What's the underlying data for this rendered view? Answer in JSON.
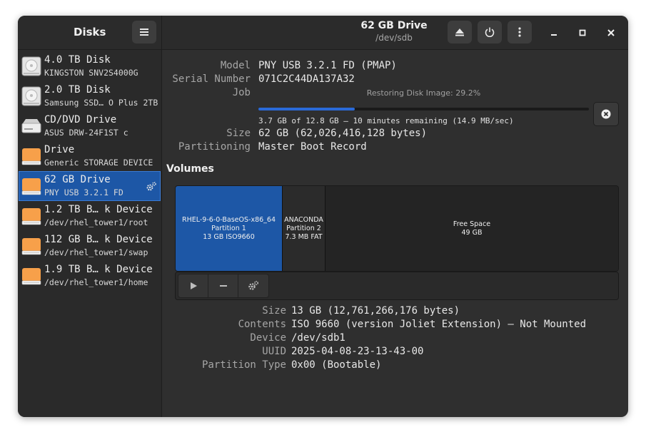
{
  "app": {
    "title": "Disks"
  },
  "header": {
    "title": "62 GB Drive",
    "subtitle": "/dev/sdb"
  },
  "sidebar": {
    "items": [
      {
        "name": "4.0 TB Disk",
        "desc": "KINGSTON SNV2S4000G",
        "icon": "hdd-icon"
      },
      {
        "name": "2.0 TB Disk",
        "desc": "Samsung SSD… O Plus 2TB",
        "icon": "hdd-icon"
      },
      {
        "name": "CD/DVD Drive",
        "desc": "ASUS    DRW-24F1ST   c",
        "icon": "optical-drive-icon"
      },
      {
        "name": "Drive",
        "desc": "Generic STORAGE DEVICE",
        "icon": "removable-drive-icon"
      },
      {
        "name": "62 GB Drive",
        "desc": "PNY USB 3.2.1 FD",
        "icon": "removable-drive-icon",
        "selected": true
      },
      {
        "name": "1.2 TB B… k Device",
        "desc": "/dev/rhel_tower1/root",
        "icon": "block-device-icon"
      },
      {
        "name": "112 GB B… k Device",
        "desc": "/dev/rhel_tower1/swap",
        "icon": "block-device-icon"
      },
      {
        "name": "1.9 TB B… k Device",
        "desc": "/dev/rhel_tower1/home",
        "icon": "block-device-icon"
      }
    ]
  },
  "drive": {
    "model_label": "Model",
    "model": "PNY USB 3.2.1 FD (PMAP)",
    "serial_label": "Serial Number",
    "serial": "071C2C44DA137A32",
    "job_label": "Job",
    "job_caption": "Restoring Disk Image: 29.2%",
    "job_progress": 0.292,
    "job_detail": "3.7 GB of 12.8 GB — 10 minutes remaining (14.9 MB/sec)",
    "size_label": "Size",
    "size": "62 GB (62,026,416,128 bytes)",
    "partitioning_label": "Partitioning",
    "partitioning": "Master Boot Record"
  },
  "volumes": {
    "title": "Volumes",
    "segments": [
      {
        "line1": "RHEL-9-6-0-BaseOS-x86_64",
        "line2": "Partition 1",
        "line3": "13 GB ISO9660"
      },
      {
        "line1": "ANACONDA",
        "line2": "Partition 2",
        "line3": "7.3 MB FAT"
      },
      {
        "line1": "Free Space",
        "line2": "49 GB",
        "line3": ""
      }
    ]
  },
  "partition": {
    "size_label": "Size",
    "size": "13 GB (12,761,266,176 bytes)",
    "contents_label": "Contents",
    "contents": "ISO 9660 (version Joliet Extension) — Not Mounted",
    "device_label": "Device",
    "device": "/dev/sdb1",
    "uuid_label": "UUID",
    "uuid": "2025-04-08-23-13-43-00",
    "type_label": "Partition Type",
    "type": "0x00 (Bootable)"
  },
  "colors": {
    "selection": "#1d57a6",
    "progress": "#2a6ad8",
    "drive_orange": "#f7a04a"
  }
}
